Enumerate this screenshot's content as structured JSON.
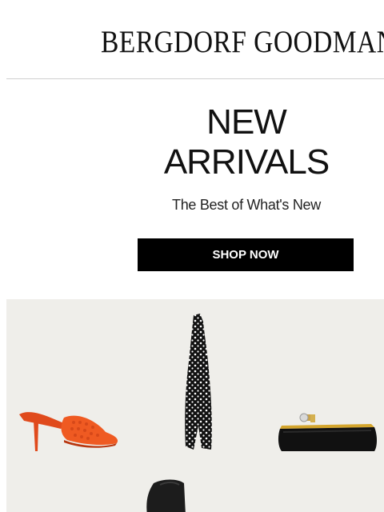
{
  "brand": {
    "logo_text": "BERGDORF GOODMAN"
  },
  "hero": {
    "headline_line1": "NEW",
    "headline_line2": "ARRIVALS",
    "subheadline": "The Best of What's New",
    "cta_label": "SHOP NOW"
  },
  "products": [
    {
      "name": "orange woven mule sandal",
      "icon": "sandal-image",
      "color": "#e8501f"
    },
    {
      "name": "black and white polka dot halter gown",
      "icon": "dress-image",
      "color": "#111111"
    },
    {
      "name": "black satin clutch with gold frame",
      "icon": "clutch-image",
      "color": "#111111"
    },
    {
      "name": "black boot",
      "icon": "boot-image",
      "color": "#1a1a1a"
    }
  ],
  "colors": {
    "panel_background": "#efeeea",
    "cta_background": "#000000",
    "cta_text": "#ffffff",
    "divider": "#cfcfcf"
  }
}
